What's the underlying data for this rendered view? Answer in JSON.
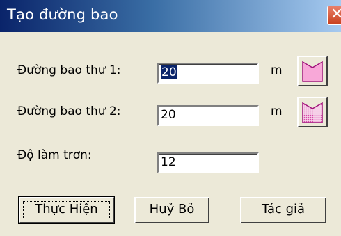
{
  "window": {
    "title": "Tạo đường bao",
    "close_glyph": "✕"
  },
  "fields": {
    "boundary1": {
      "label": "Đường bao thư 1:",
      "value": "20",
      "unit": "m",
      "icon": "pink-notched-rectangle-icon"
    },
    "boundary2": {
      "label": "Đường bao thư 2:",
      "value": "20",
      "unit": "m",
      "icon": "pink-dotted-notched-rectangle-icon"
    },
    "smoothness": {
      "label": "Độ làm trơn:",
      "value": "12"
    }
  },
  "buttons": {
    "execute": "Thực Hiện",
    "cancel": "Huỷ Bỏ",
    "author": "Tác giả"
  },
  "colors": {
    "accent": "#0a246a",
    "shape_fill": "#f8a8d8",
    "shape_outline": "#a0107a"
  }
}
